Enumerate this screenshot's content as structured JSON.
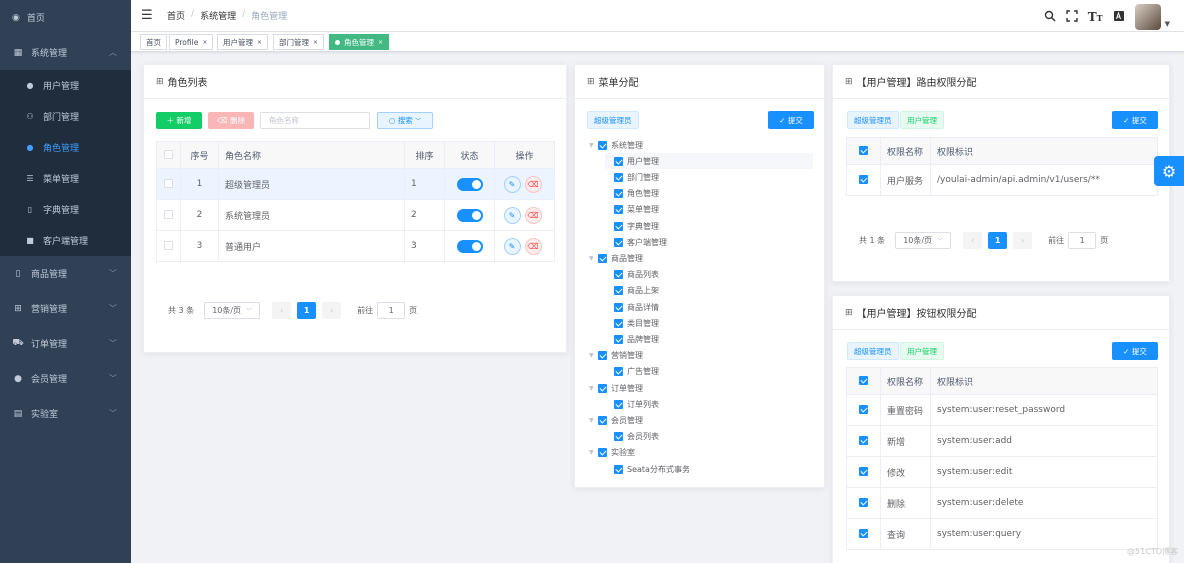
{
  "sidebar": {
    "top": {
      "label": "首页"
    },
    "group_system": {
      "label": "系统管理"
    },
    "sub_items": [
      {
        "label": "用户管理"
      },
      {
        "label": "部门管理"
      },
      {
        "label": "角色管理"
      },
      {
        "label": "菜单管理"
      },
      {
        "label": "字典管理"
      },
      {
        "label": "客户端管理"
      }
    ],
    "groups": [
      {
        "label": "商品管理"
      },
      {
        "label": "营销管理"
      },
      {
        "label": "订单管理"
      },
      {
        "label": "会员管理"
      },
      {
        "label": "实验室"
      }
    ]
  },
  "navbar": {
    "breadcrumb": [
      "首页",
      "系统管理",
      "角色管理"
    ]
  },
  "tags": [
    "首页",
    "Profile",
    "用户管理",
    "部门管理",
    "角色管理"
  ],
  "roles": {
    "title": "角色列表",
    "add_label": "新增",
    "delete_label": "删除",
    "search_placeholder": "角色名称",
    "search_label": "搜索",
    "columns": [
      "序号",
      "角色名称",
      "排序",
      "状态",
      "操作"
    ],
    "rows": [
      {
        "idx": "1",
        "name": "超级管理员",
        "sort": "1"
      },
      {
        "idx": "2",
        "name": "系统管理员",
        "sort": "2"
      },
      {
        "idx": "3",
        "name": "普通用户",
        "sort": "3"
      }
    ],
    "pager": {
      "total": "共 3 条",
      "size": "10条/页",
      "page": "1",
      "goto": "前往",
      "goto_val": "1",
      "unit": "页"
    }
  },
  "menu": {
    "title": "菜单分配",
    "role_badge": "超级管理员",
    "submit": "提交",
    "tree": [
      {
        "label": "系统管理",
        "level": 0
      },
      {
        "label": "用户管理",
        "level": 1
      },
      {
        "label": "部门管理",
        "level": 1
      },
      {
        "label": "角色管理",
        "level": 1
      },
      {
        "label": "菜单管理",
        "level": 1
      },
      {
        "label": "字典管理",
        "level": 1
      },
      {
        "label": "客户端管理",
        "level": 1
      },
      {
        "label": "商品管理",
        "level": 0
      },
      {
        "label": "商品列表",
        "level": 1
      },
      {
        "label": "商品上架",
        "level": 1
      },
      {
        "label": "商品详情",
        "level": 1
      },
      {
        "label": "类目管理",
        "level": 1
      },
      {
        "label": "品牌管理",
        "level": 1
      },
      {
        "label": "营销管理",
        "level": 0
      },
      {
        "label": "广告管理",
        "level": 1
      },
      {
        "label": "订单管理",
        "level": 0
      },
      {
        "label": "订单列表",
        "level": 1
      },
      {
        "label": "会员管理",
        "level": 0
      },
      {
        "label": "会员列表",
        "level": 1
      },
      {
        "label": "实验室",
        "level": 0
      },
      {
        "label": "Seata分布式事务",
        "level": 1
      }
    ]
  },
  "route_perm": {
    "title": "【用户管理】路由权限分配",
    "badge_role": "超级管理员",
    "badge_menu": "用户管理",
    "submit": "提交",
    "columns": [
      "权限名称",
      "权限标识"
    ],
    "rows": [
      {
        "name": "用户服务",
        "code": "/youlai-admin/api.admin/v1/users/**"
      }
    ],
    "pager": {
      "total": "共 1 条",
      "size": "10条/页",
      "page": "1",
      "goto": "前往",
      "goto_val": "1",
      "unit": "页"
    }
  },
  "button_perm": {
    "title": "【用户管理】按钮权限分配",
    "badge_role": "超级管理员",
    "badge_menu": "用户管理",
    "submit": "提交",
    "columns": [
      "权限名称",
      "权限标识"
    ],
    "rows": [
      {
        "name": "重置密码",
        "code": "system:user:reset_password"
      },
      {
        "name": "新增",
        "code": "system:user:add"
      },
      {
        "name": "修改",
        "code": "system:user:edit"
      },
      {
        "name": "删除",
        "code": "system:user:delete"
      },
      {
        "name": "查询",
        "code": "system:user:query"
      }
    ]
  },
  "watermark": "@51CTO博客",
  "colors": {
    "primary": "#1890ff",
    "sidebar": "#304156",
    "success": "#13ce66",
    "tag_active": "#42b983"
  }
}
